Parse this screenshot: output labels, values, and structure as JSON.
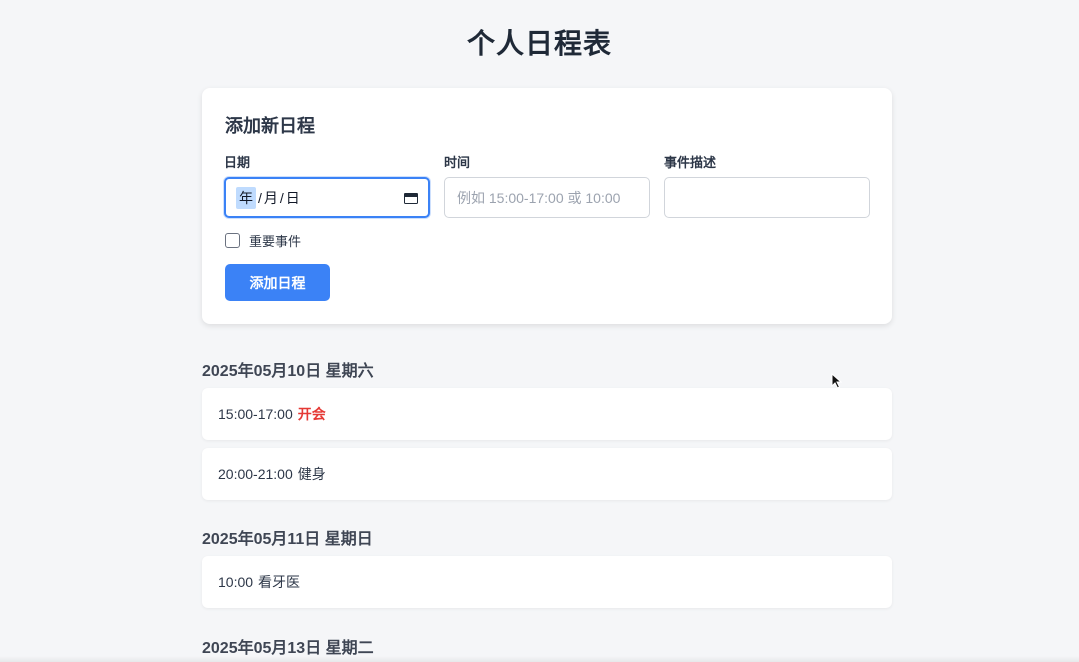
{
  "page": {
    "title": "个人日程表"
  },
  "form": {
    "title": "添加新日程",
    "date_label": "日期",
    "date_segments": {
      "year": "年",
      "month": "月",
      "day": "日"
    },
    "time_label": "时间",
    "time_placeholder": "例如 15:00-17:00 或 10:00",
    "desc_label": "事件描述",
    "desc_value": "",
    "important_label": "重要事件",
    "important_checked": false,
    "submit_label": "添加日程"
  },
  "schedule": [
    {
      "date": "2025年05月10日 星期六",
      "events": [
        {
          "time": "15:00-17:00",
          "desc": "开会",
          "important": true
        },
        {
          "time": "20:00-21:00",
          "desc": "健身",
          "important": false
        }
      ]
    },
    {
      "date": "2025年05月11日 星期日",
      "events": [
        {
          "time": "10:00",
          "desc": "看牙医",
          "important": false
        }
      ]
    },
    {
      "date": "2025年05月13日 星期二",
      "events": []
    }
  ],
  "colors": {
    "accent": "#3b82f6",
    "important": "#e53935",
    "background": "#f5f6f8"
  }
}
